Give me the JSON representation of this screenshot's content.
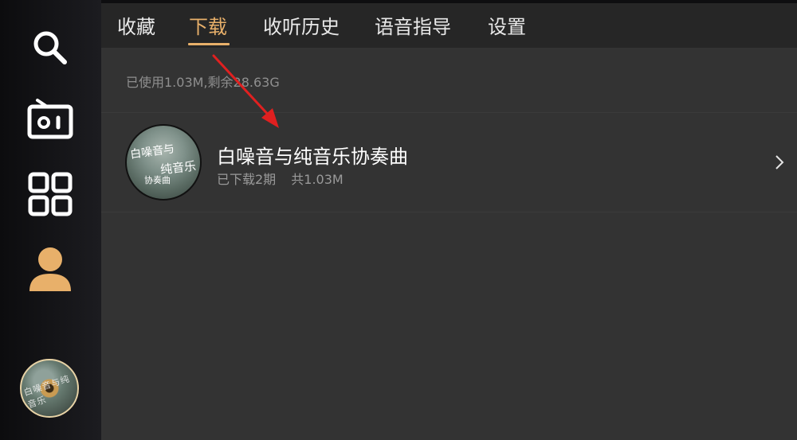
{
  "sidebar": {
    "items": [
      {
        "icon": "search-icon"
      },
      {
        "icon": "radio-icon"
      },
      {
        "icon": "apps-grid-icon"
      },
      {
        "icon": "profile-icon"
      }
    ],
    "now_playing": {
      "cover_text": "白噪音与纯音乐"
    }
  },
  "tabs": [
    {
      "label": "收藏",
      "active": false
    },
    {
      "label": "下载",
      "active": true
    },
    {
      "label": "收听历史",
      "active": false
    },
    {
      "label": "语音指导",
      "active": false
    },
    {
      "label": "设置",
      "active": false
    }
  ],
  "storage": {
    "text": "已使用1.03M,剩余28.63G"
  },
  "downloads": [
    {
      "title": "白噪音与纯音乐协奏曲",
      "downloaded": "已下载2期",
      "total": "共1.03M",
      "cover": {
        "line1": "白噪音与",
        "line2": "纯音乐",
        "line3": "协奏曲"
      }
    }
  ],
  "colors": {
    "accent": "#e8b06a",
    "background": "#333333",
    "sidebar": "#141417",
    "annotation": "#e02020"
  }
}
